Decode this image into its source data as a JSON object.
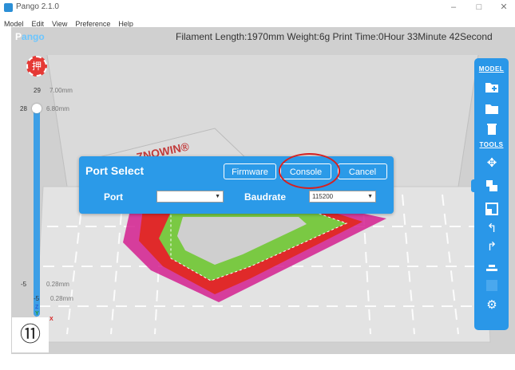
{
  "window": {
    "title": "Pango 2.1.0",
    "buttons": [
      "–",
      "□",
      "✕"
    ]
  },
  "menu": [
    "Model",
    "Edit",
    "View",
    "Preference",
    "Help"
  ],
  "logo": {
    "part1": "P",
    "part2": "ango"
  },
  "stats": "Filament Length:1970mm  Weight:6g  Print Time:0Hour 33Minute 42Second",
  "record_button": "押",
  "layer_slider": {
    "top_layer": "29",
    "top_height": "7.00mm",
    "current_layer": "28",
    "current_height": "6.80mm",
    "bottom_current_layer": "-5",
    "bottom_current_height": "0.28mm",
    "bottom_layer": "-5",
    "bottom_height": "0.28mm",
    "position_fraction": 1.0
  },
  "axis": {
    "z": "Z",
    "y": "Y",
    "x": "X"
  },
  "bed_brand": "ZNOWIN®",
  "toolbar": {
    "model_heading": "MODEL",
    "tools_heading": "TOOLS",
    "model_icons": [
      "add-model-icon",
      "open-folder-icon",
      "trash-icon"
    ],
    "tool_icons": [
      "move-icon",
      "scale-icon",
      "rotate-icon",
      "undo-icon",
      "redo-icon",
      "layer-icon",
      "disabled-icon",
      "settings-icon"
    ]
  },
  "dialog": {
    "title": "Port Select",
    "firmware_button": "Firmware",
    "console_button": "Console",
    "cancel_button": "Cancel",
    "port_label": "Port",
    "port_value": "",
    "baudrate_label": "Baudrate",
    "baudrate_value": "115200"
  },
  "step_marker": "⑪",
  "colors": {
    "accent": "#2b9ae8",
    "highlight_circle": "#d62020",
    "print_outer": "#d4208f",
    "print_inner": "#e02a2a",
    "print_top": "#7ac943"
  }
}
